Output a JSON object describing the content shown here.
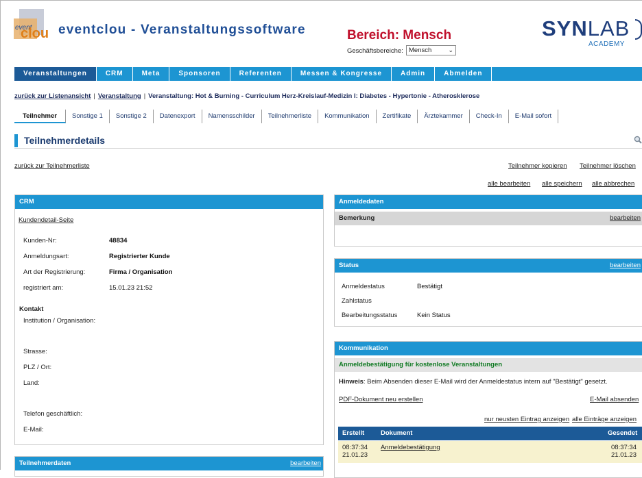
{
  "header": {
    "logo_top": "event",
    "logo_bottom": "clou",
    "app_title": "eventclou - Veranstaltungssoftware",
    "bereich": "Bereich: Mensch",
    "geschaeftsbereiche_label": "Geschäftsbereiche:",
    "geschaeftsbereiche_value": "Mensch",
    "brand_bold": "SYN",
    "brand_light": "LAB",
    "brand_sub": "ACADEMY"
  },
  "mainnav": [
    "Veranstaltungen",
    "CRM",
    "Meta",
    "Sponsoren",
    "Referenten",
    "Messen & Kongresse",
    "Admin",
    "Abmelden"
  ],
  "breadcrumb": {
    "back": "zurück zur Listenansicht",
    "veranstaltung": "Veranstaltung",
    "current": "Veranstaltung: Hot & Burning - Curriculum Herz-Kreislauf-Medizin I: Diabetes - Hypertonie - Atherosklerose"
  },
  "subnav": [
    "Teilnehmer",
    "Sonstige 1",
    "Sonstige 2",
    "Datenexport",
    "Namensschilder",
    "Teilnehmerliste",
    "Kommunikation",
    "Zertifikate",
    "Ärztekammer",
    "Check-In",
    "E-Mail sofort"
  ],
  "section_title": "Teilnehmerdetails",
  "actions": {
    "back_to_list": "zurück zur Teilnehmerliste",
    "copy": "Teilnehmer kopieren",
    "delete": "Teilnehmer löschen",
    "edit_all": "alle bearbeiten",
    "save_all": "alle speichern",
    "cancel_all": "alle abbrechen"
  },
  "crm": {
    "title": "CRM",
    "detail_link": "Kundendetail-Seite",
    "fields": [
      {
        "label": "Kunden-Nr:",
        "value": "48834"
      },
      {
        "label": "Anmeldungsart:",
        "value": "Registrierter Kunde"
      },
      {
        "label": "Art der Registrierung:",
        "value": "Firma / Organisation"
      },
      {
        "label": "registriert am:",
        "value": "15.01.23 21:52"
      }
    ],
    "kontakt_title": "Kontakt",
    "kontakt": {
      "institution": "Institution / Organisation:",
      "strasse": "Strasse:",
      "plz": "PLZ / Ort:",
      "land": "Land:",
      "telefon": "Telefon geschäftlich:",
      "email": "E-Mail:"
    }
  },
  "teilnehmerdaten": {
    "title": "Teilnehmerdaten",
    "edit": "bearbeiten"
  },
  "anmeldedaten": {
    "title": "Anmeldedaten",
    "bemerkung": "Bemerkung",
    "edit": "bearbeiten"
  },
  "status": {
    "title": "Status",
    "edit": "bearbeiten",
    "rows": [
      {
        "label": "Anmeldestatus",
        "value": "Bestätigt"
      },
      {
        "label": "Zahlstatus",
        "value": ""
      },
      {
        "label": "Bearbeitungsstatus",
        "value": "Kein Status"
      }
    ]
  },
  "kommunikation": {
    "title": "Kommunikation",
    "subtitle": "Anmeldebestätigung für kostenlose Veranstaltungen",
    "hint_label": "Hinweis",
    "hint_text": ": Beim Absenden dieser E-Mail wird der Anmeldestatus intern auf \"Bestätigt\" gesetzt.",
    "pdf_new": "PDF-Dokument neu erstellen",
    "send_email": "E-Mail absenden",
    "only_newest": "nur neusten Eintrag anzeigen",
    "all_entries": "alle Einträge anzeigen",
    "columns": {
      "created": "Erstellt",
      "document": "Dokument",
      "sent": "Gesendet"
    },
    "rows": [
      {
        "created_time": "08:37:34",
        "created_date": "21.01.23",
        "document": "Anmeldebestätigung",
        "sent_time": "08:37:34",
        "sent_date": "21.01.23"
      }
    ]
  }
}
